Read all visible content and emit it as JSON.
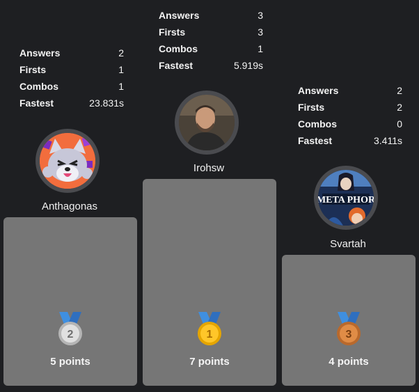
{
  "labels": {
    "answers": "Answers",
    "firsts": "Firsts",
    "combos": "Combos",
    "fastest": "Fastest"
  },
  "players": {
    "second": {
      "name": "Anthagonas",
      "answers": "2",
      "firsts": "1",
      "combos": "1",
      "fastest": "23.831s",
      "points": "5 points",
      "rank": "2",
      "medal_color": "#c9c9c9"
    },
    "first": {
      "name": "Irohsw",
      "answers": "3",
      "firsts": "3",
      "combos": "1",
      "fastest": "5.919s",
      "points": "7 points",
      "rank": "1",
      "medal_color": "#f2b400"
    },
    "third": {
      "name": "Svartah",
      "answers": "2",
      "firsts": "2",
      "combos": "0",
      "fastest": "3.411s",
      "points": "4 points",
      "rank": "3",
      "medal_color": "#cd7c3a"
    }
  },
  "avatars": {
    "second_logo_text": "",
    "third_logo_text": "META PHOR"
  },
  "colors": {
    "background": "#1e1f22",
    "podium": "#767676",
    "ribbon": "#3f8fe0"
  }
}
